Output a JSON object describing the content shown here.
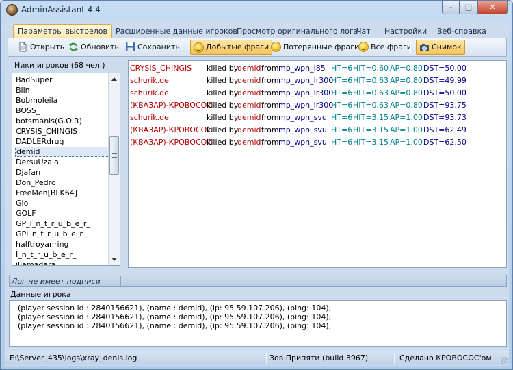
{
  "window": {
    "title": "AdminAssistant 4.4",
    "controls": {
      "minimize": "–",
      "maximize": "□",
      "close": "✕"
    }
  },
  "tabs": [
    {
      "label": "Параметры выстрелов"
    },
    {
      "label": "Расширенные данные игроков"
    },
    {
      "label": "Просмотр оригинального лога"
    },
    {
      "label": "Чат"
    },
    {
      "label": "Настройки"
    },
    {
      "label": "Веб-справка"
    }
  ],
  "toolbar": {
    "open_label": "Открыть",
    "refresh_label": "Обновить",
    "save_label": "Сохранить",
    "gained_frags_label": "Добытые фраги",
    "lost_frags_label": "Потерянные фраги",
    "all_frags_label": "Все фраги",
    "snapshot_label": "Снимок"
  },
  "players": {
    "header": "Ники игроков (68 чел.)",
    "selected": "demid",
    "items": [
      "BadSuper",
      "Blin",
      "Bobmoleila",
      "BOSS_",
      "botsmanis(G.O.R)",
      "CRYSIS_CHINGIS",
      "DADLERdrug",
      "demid",
      "DersuUzala",
      "Djafarr",
      "Don_Pedro",
      "FreeMen[BLK64]",
      "Gio",
      "GOLF",
      "GP_I_n_t_r_u_b_e_r_",
      "GPI_n_t_r_u_b_e_r_",
      "halftroyanring",
      "I_n_t_r_u_b_e_r_",
      "iliamadara"
    ]
  },
  "log": {
    "killed_text": "killed by",
    "from_text": "from",
    "rows": [
      {
        "victim": "CRYSIS_CHINGIS",
        "killer": "demid",
        "weapon": "mp_wpn_l85",
        "ht": "HT=6",
        "hit": "HIT=0.60",
        "ap": "AP=0.80",
        "dst": "DST=50.00"
      },
      {
        "victim": "schurik.de",
        "killer": "demid",
        "weapon": "mp_wpn_lr300",
        "ht": "HT=6",
        "hit": "HIT=0.63",
        "ap": "AP=0.80",
        "dst": "DST=49.99"
      },
      {
        "victim": "schurik.de",
        "killer": "demid",
        "weapon": "mp_wpn_lr300",
        "ht": "HT=6",
        "hit": "HIT=0.63",
        "ap": "AP=0.80",
        "dst": "DST=50.00"
      },
      {
        "victim": "(КВАЗАР)-КРОВОСОС",
        "killer": "demid",
        "weapon": "mp_wpn_lr300",
        "ht": "HT=6",
        "hit": "HIT=0.63",
        "ap": "AP=0.80",
        "dst": "DST=93.75"
      },
      {
        "victim": "schurik.de",
        "killer": "demid",
        "weapon": "mp_wpn_svu",
        "ht": "HT=6",
        "hit": "HIT=3.15",
        "ap": "AP=1.00",
        "dst": "DST=93.73"
      },
      {
        "victim": "(КВАЗАР)-КРОВОСОС",
        "killer": "demid",
        "weapon": "mp_wpn_svu",
        "ht": "HT=6",
        "hit": "HIT=3.15",
        "ap": "AP=1.00",
        "dst": "DST=62.49"
      },
      {
        "victim": "(КВАЗАР)-КРОВОСОС",
        "killer": "demid",
        "weapon": "mp_wpn_svu",
        "ht": "HT=6",
        "hit": "HIT=3.15",
        "ap": "AP=1.00",
        "dst": "DST=62.50"
      }
    ]
  },
  "signature": {
    "text": "Лог не имеет подписи"
  },
  "player_data": {
    "label": "Данные игрока",
    "lines": [
      "(player session id : 2840156621), (name : demid), (ip: 95.59.107.206), (ping: 104);",
      "(player session id : 2840156621), (name : demid), (ip: 95.59.107.206), (ping: 104);",
      "(player session id : 2840156621), (name : demid), (ip: 95.59.107.206), (ping: 104);"
    ]
  },
  "statusbar": {
    "path": "E:\\Server_435\\logs\\xray_denis.log",
    "server": "Зов Припяти (build 3967)",
    "credit": "Сделано КРОВОСОС'ом"
  }
}
